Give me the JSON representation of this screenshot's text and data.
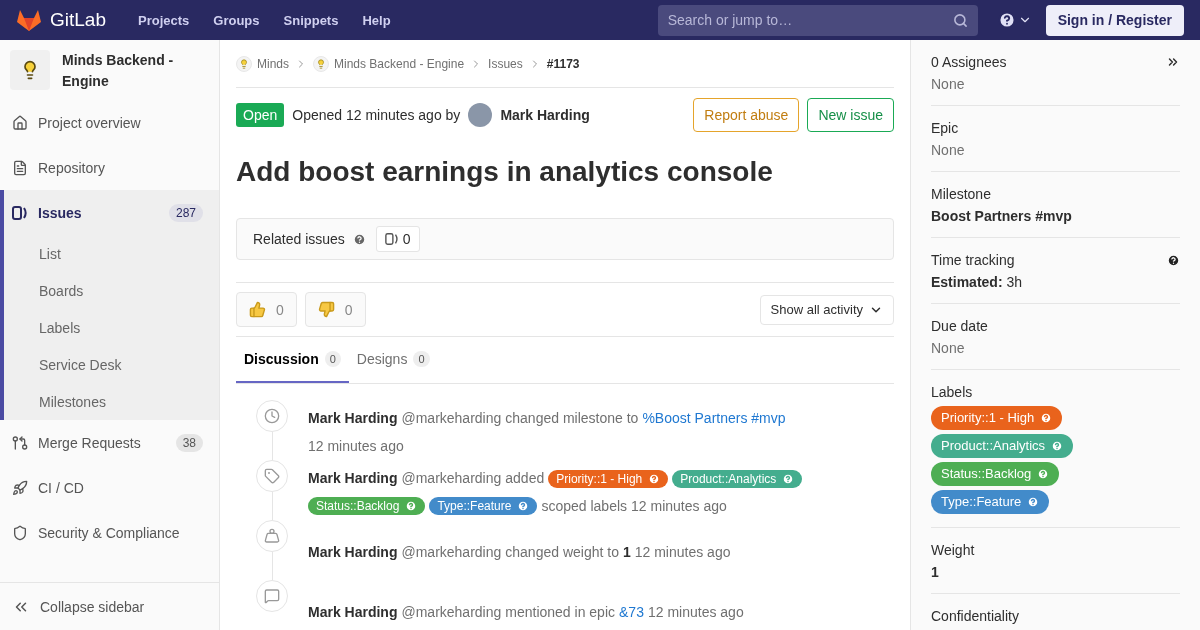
{
  "header": {
    "logo_text": "GitLab",
    "nav": [
      "Projects",
      "Groups",
      "Snippets",
      "Help"
    ],
    "search": {
      "placeholder": "Search or jump to…"
    },
    "sign_in": "Sign in / Register"
  },
  "sidebar": {
    "project_name": "Minds Backend - Engine",
    "items": [
      {
        "kind": "overview",
        "label": "Project overview",
        "selected": false
      },
      {
        "kind": "repository",
        "label": "Repository",
        "selected": false
      },
      {
        "kind": "issues",
        "label": "Issues",
        "count": "287",
        "selected": true,
        "children": [
          {
            "label": "List"
          },
          {
            "label": "Boards"
          },
          {
            "label": "Labels"
          },
          {
            "label": "Service Desk"
          },
          {
            "label": "Milestones"
          }
        ]
      },
      {
        "kind": "merge",
        "label": "Merge Requests",
        "count": "38",
        "selected": false
      },
      {
        "kind": "cicd",
        "label": "CI / CD",
        "selected": false
      },
      {
        "kind": "security",
        "label": "Security & Compliance",
        "selected": false
      }
    ],
    "collapse": "Collapse sidebar"
  },
  "breadcrumbs": [
    {
      "label": "Minds",
      "kind": "group"
    },
    {
      "label": "Minds Backend - Engine",
      "kind": "project"
    },
    {
      "label": "Issues",
      "kind": "section"
    },
    {
      "label": "#1173",
      "kind": "issue"
    }
  ],
  "issue": {
    "status": "Open",
    "opened": "Opened 12 minutes ago by",
    "author": "Mark Harding",
    "buttons": [
      {
        "label": "Report abuse",
        "kind": "warning"
      },
      {
        "label": "New issue",
        "kind": "success"
      }
    ],
    "title": "Add boost earnings in analytics console"
  },
  "related": {
    "label": "Related issues",
    "count": "0"
  },
  "awards": [
    {
      "kind": "thumbsup",
      "count": "0"
    },
    {
      "kind": "thumbsdown",
      "count": "0"
    }
  ],
  "activity_filter": "Show all activity",
  "tabs": [
    {
      "label": "Discussion",
      "count": "0",
      "selected": true
    },
    {
      "label": "Designs",
      "count": "0",
      "selected": false
    }
  ],
  "activity": [
    {
      "kind": "milestone",
      "author": "Mark Harding",
      "handle": "@markeharding",
      "parts": [
        {
          "kind": "text",
          "text": "changed milestone to"
        },
        {
          "kind": "link",
          "text": "%Boost Partners #mvp"
        }
      ],
      "time": "12 minutes ago"
    },
    {
      "kind": "label",
      "author": "Mark Harding",
      "handle": "@markeharding",
      "parts": [
        {
          "kind": "text",
          "text": "added"
        },
        {
          "kind": "label",
          "text": "Priority::1 - High",
          "color": "#e9631c"
        },
        {
          "kind": "label",
          "text": "Product::Analytics",
          "color": "#44ad8e"
        },
        {
          "kind": "label",
          "text": "Status::Backlog",
          "color": "#4eae53"
        },
        {
          "kind": "label",
          "text": "Type::Feature",
          "color": "#428bca"
        },
        {
          "kind": "text",
          "text": "scoped labels"
        }
      ],
      "time": "12 minutes ago"
    },
    {
      "kind": "weight",
      "author": "Mark Harding",
      "handle": "@markeharding",
      "parts": [
        {
          "kind": "text",
          "text": "changed weight to"
        },
        {
          "kind": "bold",
          "text": "1"
        }
      ],
      "time": "12 minutes ago"
    },
    {
      "kind": "comment",
      "author": "Mark Harding",
      "handle": "@markeharding",
      "parts": [
        {
          "kind": "text",
          "text": "mentioned in epic"
        },
        {
          "kind": "link",
          "text": "&73"
        }
      ],
      "time": "12 minutes ago"
    }
  ],
  "right_sidebar": [
    {
      "title": "0 Assignees",
      "value": "None",
      "kind": "assignees"
    },
    {
      "title": "Epic",
      "value": "None",
      "kind": "epic"
    },
    {
      "title": "Milestone",
      "value": "Boost Partners #mvp",
      "kind": "milestone"
    },
    {
      "title": "Time tracking",
      "value": "**Estimated:** 3h",
      "kind": "time_tracking"
    },
    {
      "title": "Due date",
      "value": "None",
      "kind": "due_date"
    },
    {
      "title": "Labels",
      "kind": "labels",
      "labels": [
        {
          "text": "Priority::1 - High",
          "color": "#e9631c"
        },
        {
          "text": "Product::Analytics",
          "color": "#44ad8e"
        },
        {
          "text": "Status::Backlog",
          "color": "#4eae53"
        },
        {
          "text": "Type::Feature",
          "color": "#428bca"
        }
      ]
    },
    {
      "title": "Weight",
      "value": "1",
      "kind": "weight"
    },
    {
      "title": "Confidentiality",
      "kind": "confidentiality"
    }
  ]
}
